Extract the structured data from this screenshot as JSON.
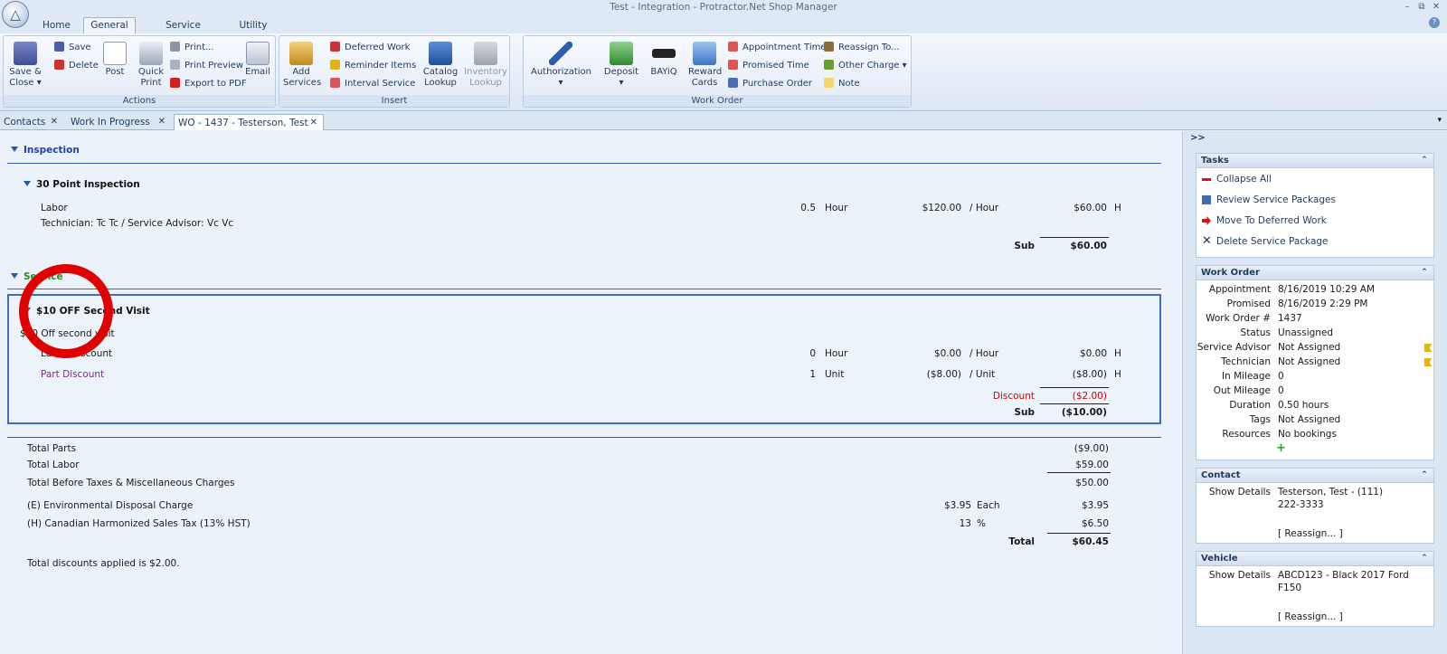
{
  "window": {
    "title": "Test - Integration - Protractor.Net Shop Manager"
  },
  "ribbon_tabs": [
    "Home",
    "General",
    "Service Package",
    "Utility"
  ],
  "ribbon": {
    "actions": {
      "save_close": "Save &",
      "save_close2": "Close",
      "save": "Save",
      "delete": "Delete",
      "post": "Post",
      "quick_print": "Quick",
      "quick_print2": "Print",
      "print": "Print...",
      "print_preview": "Print Preview",
      "export_pdf": "Export to PDF",
      "email": "Email",
      "label": "Actions"
    },
    "insert": {
      "add_services": "Add",
      "add_services2": "Services",
      "deferred_work": "Deferred Work",
      "reminder_items": "Reminder Items",
      "interval_service": "Interval Service",
      "catalog_lookup": "Catalog",
      "catalog_lookup2": "Lookup",
      "inventory_lookup": "Inventory",
      "inventory_lookup2": "Lookup",
      "label": "Insert"
    },
    "work_order": {
      "authorization": "Authorization",
      "deposit": "Deposit",
      "bayiq": "BAYiQ",
      "reward_cards": "Reward",
      "reward_cards2": "Cards",
      "appointment_time": "Appointment Time",
      "promised_time": "Promised Time",
      "purchase_order": "Purchase Order",
      "reassign_to": "Reassign To...",
      "other_charge": "Other Charge",
      "note": "Note",
      "label": "Work Order"
    }
  },
  "doc_tabs": [
    "Contacts",
    "Work In Progress",
    "WO - 1437 - Testerson, Test"
  ],
  "inspection": {
    "header": "Inspection",
    "item_title": "30 Point Inspection",
    "labor_label": "Labor",
    "labor_qty": "0.5",
    "labor_unit": "Hour",
    "labor_rate": "$120.00",
    "labor_per": "/ Hour",
    "labor_total": "$60.00",
    "labor_flag": "H",
    "tech_line": "Technician: Tc Tc / Service Advisor: Vc Vc",
    "sub_label": "Sub",
    "sub_value": "$60.00"
  },
  "service": {
    "header": "Service",
    "item_title": "$10 OFF Second Visit",
    "description": "$10 Off second visit",
    "rows": [
      {
        "name": "Labor Discount",
        "qty": "0",
        "unit": "Hour",
        "rate": "$0.00",
        "per": "/ Hour",
        "total": "$0.00",
        "flag": "H"
      },
      {
        "name": "Part Discount",
        "qty": "1",
        "unit": "Unit",
        "rate": "($8.00)",
        "per": "/ Unit",
        "total": "($8.00)",
        "flag": "H"
      }
    ],
    "discount_label": "Discount",
    "discount_value": "($2.00)",
    "sub_label": "Sub",
    "sub_value": "($10.00)"
  },
  "totals": {
    "total_parts_label": "Total Parts",
    "total_parts": "($9.00)",
    "total_labor_label": "Total Labor",
    "total_labor": "$59.00",
    "before_taxes_label": "Total Before Taxes & Miscellaneous Charges",
    "before_taxes": "$50.00",
    "env_label": "(E) Environmental Disposal Charge",
    "env_rate": "$3.95",
    "env_per": "Each",
    "env_value": "$3.95",
    "hst_label": "(H) Canadian Harmonized Sales Tax (13% HST)",
    "hst_rate": "13",
    "hst_per": "%",
    "hst_value": "$6.50",
    "total_label": "Total",
    "total_value": "$60.45",
    "discount_note": "Total discounts applied is $2.00."
  },
  "panel": {
    "expand": ">>",
    "tasks": {
      "title": "Tasks",
      "items": [
        "Collapse All",
        "Review Service Packages",
        "Move To Deferred Work",
        "Delete Service Package"
      ]
    },
    "work_order": {
      "title": "Work Order",
      "fields": [
        {
          "k": "Appointment",
          "v": "8/16/2019 10:29 AM"
        },
        {
          "k": "Promised",
          "v": "8/16/2019 2:29 PM"
        },
        {
          "k": "Work Order #",
          "v": "1437"
        },
        {
          "k": "Status",
          "v": "Unassigned"
        },
        {
          "k": "Service Advisor",
          "v": "Not Assigned"
        },
        {
          "k": "Technician",
          "v": "Not Assigned"
        },
        {
          "k": "In Mileage",
          "v": "0"
        },
        {
          "k": "Out Mileage",
          "v": "0"
        },
        {
          "k": "Duration",
          "v": "0.50 hours"
        },
        {
          "k": "Tags",
          "v": "Not Assigned"
        },
        {
          "k": "Resources",
          "v": "No bookings"
        }
      ]
    },
    "contact": {
      "title": "Contact",
      "show_details": "Show Details",
      "line1": "Testerson, Test - (111)",
      "line2": "222-3333",
      "reassign": "[ Reassign... ]"
    },
    "vehicle": {
      "title": "Vehicle",
      "show_details": "Show Details",
      "line1": "ABCD123 - Black 2017 Ford",
      "line2": "F150",
      "reassign": "[ Reassign... ]"
    }
  }
}
